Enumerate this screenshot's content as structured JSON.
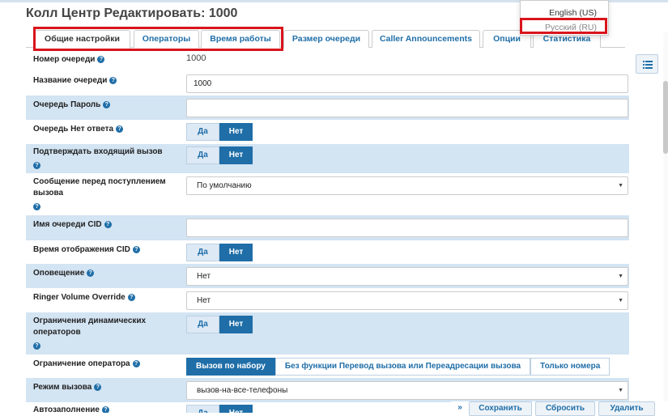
{
  "page": {
    "title": "Колл Центр Редактировать: 1000"
  },
  "language_menu": {
    "english": "English (US)",
    "russian": "Русский (RU)"
  },
  "tabs": [
    {
      "label": "Общие настройки",
      "active": true
    },
    {
      "label": "Операторы"
    },
    {
      "label": "Время работы"
    },
    {
      "label": "Размер очереди"
    },
    {
      "label": "Caller Announcements"
    },
    {
      "label": "Опции"
    },
    {
      "label": "Статистика"
    }
  ],
  "help_glyph": "?",
  "form": {
    "queue_number": {
      "label": "Номер очереди",
      "value": "1000"
    },
    "queue_name": {
      "label": "Название очереди",
      "value": "1000"
    },
    "queue_password": {
      "label": "Очередь Пароль",
      "value": ""
    },
    "queue_no_answer": {
      "label": "Очередь Нет ответа",
      "yes": "Да",
      "no": "Нет",
      "selected": "no"
    },
    "confirm_call": {
      "label": "Подтверждать входящий вызов",
      "yes": "Да",
      "no": "Нет",
      "selected": "no"
    },
    "pre_message": {
      "label_line1": "Сообщение перед поступлением",
      "label_line2": "вызова",
      "value": "По умолчанию"
    },
    "cid_name": {
      "label": "Имя очереди CID",
      "value": ""
    },
    "cid_time": {
      "label": "Время отображения CID",
      "yes": "Да",
      "no": "Нет",
      "selected": "no"
    },
    "alert": {
      "label": "Оповещение",
      "value": "Нет"
    },
    "ringer_volume": {
      "label": "Ringer Volume Override",
      "value": "Нет"
    },
    "dynamic_limits": {
      "label_line1": "Ограничения динамических",
      "label_line2": "операторов",
      "yes": "Да",
      "no": "Нет",
      "selected": "no"
    },
    "operator_limit": {
      "label": "Ограничение оператора",
      "options": [
        "Вызов по набору",
        "Без функции Перевод вызова или Переадресации вызова",
        "Только номера"
      ],
      "selected": 0
    },
    "call_mode": {
      "label": "Режим вызова",
      "value": "вызов-на-все-телефоны"
    },
    "autofill": {
      "label": "Автозаполнение",
      "yes": "Да",
      "no": "Нет",
      "selected": "no"
    }
  },
  "footer": {
    "expand": "»",
    "save": "Сохранить",
    "reset": "Сбросить",
    "delete": "Удалить"
  }
}
